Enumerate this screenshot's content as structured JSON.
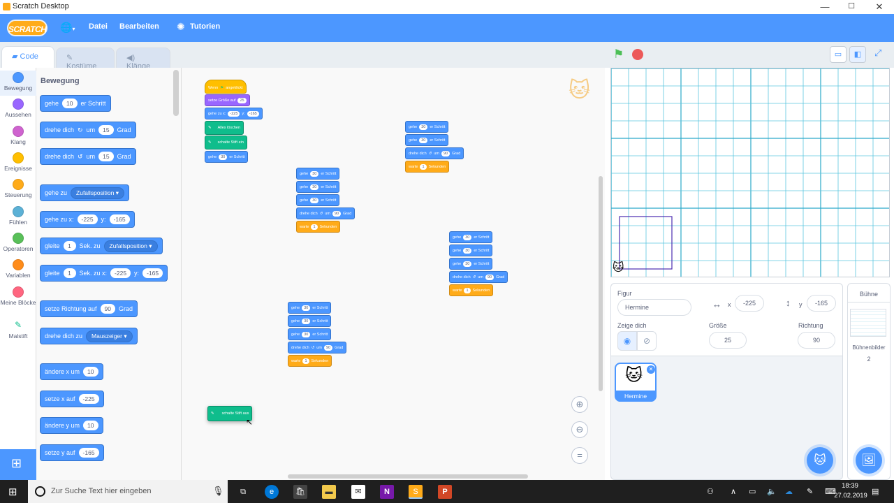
{
  "window": {
    "title": "Scratch Desktop",
    "minimize": "—",
    "maximize": "☐",
    "close": "✕"
  },
  "menu": {
    "logo": "SCRATCH",
    "file": "Datei",
    "edit": "Bearbeiten",
    "tutorials": "Tutorien"
  },
  "tabs": {
    "code": "Code",
    "costumes": "Kostüme",
    "sounds": "Klänge"
  },
  "categories": [
    {
      "label": "Bewegung",
      "color": "#4c97ff"
    },
    {
      "label": "Aussehen",
      "color": "#9966ff"
    },
    {
      "label": "Klang",
      "color": "#cf63cf"
    },
    {
      "label": "Ereignisse",
      "color": "#ffbf00"
    },
    {
      "label": "Steuerung",
      "color": "#ffab19"
    },
    {
      "label": "Fühlen",
      "color": "#5cb1d6"
    },
    {
      "label": "Operatoren",
      "color": "#59c059"
    },
    {
      "label": "Variablen",
      "color": "#ff8c1a"
    },
    {
      "label": "Meine Blöcke",
      "color": "#ff6680"
    },
    {
      "label": "Malstift",
      "color": "#0fbd8c"
    }
  ],
  "palette": {
    "title": "Bewegung",
    "move": {
      "a": "gehe",
      "v": "10",
      "b": "er Schritt"
    },
    "turn_right": {
      "a": "drehe dich",
      "b": "um",
      "v": "15",
      "c": "Grad"
    },
    "turn_left": {
      "a": "drehe dich",
      "b": "um",
      "v": "15",
      "c": "Grad"
    },
    "goto": {
      "a": "gehe zu",
      "d": "Zufallsposition"
    },
    "gotoxy": {
      "a": "gehe zu x:",
      "x": "-225",
      "b": "y:",
      "y": "-165"
    },
    "glide": {
      "a": "gleite",
      "v": "1",
      "b": "Sek. zu",
      "d": "Zufallsposition"
    },
    "glidexy": {
      "a": "gleite",
      "v": "1",
      "b": "Sek. zu x:",
      "x": "-225",
      "c": "y:",
      "y": "-165"
    },
    "point": {
      "a": "setze Richtung auf",
      "v": "90",
      "b": "Grad"
    },
    "pointto": {
      "a": "drehe dich zu",
      "d": "Mauszeiger"
    },
    "changex": {
      "a": "ändere x um",
      "v": "10"
    },
    "setx": {
      "a": "setze x auf",
      "v": "-225"
    },
    "changey": {
      "a": "ändere y um",
      "v": "10"
    },
    "sety": {
      "a": "setze y auf",
      "v": "-165"
    }
  },
  "script": {
    "hat": "Wenn",
    "hat_b": "angeklickt",
    "size": "setze Größe auf",
    "size_v": "25",
    "goto": "gehe zu x:",
    "goto_x": "-225",
    "goto_y": "-165",
    "goto_ylbl": "y:",
    "clear": "Alles löschen",
    "pendown": "schalte Stift ein",
    "penup": "schalte Stift aus",
    "move": "gehe",
    "move_v": "30",
    "move_b": "er Schritt",
    "turn": "drehe dich",
    "turn_b": "um",
    "turn_v": "90",
    "turn_c": "Grad",
    "wait": "warte",
    "wait_v": "1",
    "wait_b": "Sekunden"
  },
  "sprite": {
    "label_sprite": "Figur",
    "name": "Hermine",
    "x_label": "x",
    "x": "-225",
    "y_label": "y",
    "y": "-165",
    "show_label": "Zeige dich",
    "size_label": "Größe",
    "size": "25",
    "dir_label": "Richtung",
    "dir": "90",
    "thumb_name": "Hermine"
  },
  "stage_pane": {
    "title": "Bühne",
    "backdrops_label": "Bühnenbilder",
    "backdrops": "2"
  },
  "taskbar": {
    "search": "Zur Suche Text hier eingeben",
    "time": "18:39",
    "date": "27.02.2019"
  }
}
